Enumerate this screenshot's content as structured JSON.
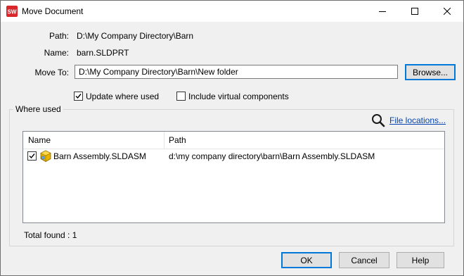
{
  "window": {
    "title": "Move Document",
    "app_icon": "solidworks-icon",
    "controls": [
      "minimize-icon",
      "maximize-icon",
      "close-icon"
    ]
  },
  "form": {
    "path_label": "Path:",
    "path_value": "D:\\My Company Directory\\Barn",
    "name_label": "Name:",
    "name_value": "barn.SLDPRT",
    "move_to_label": "Move To:",
    "move_to_value": "D:\\My Company Directory\\Barn\\New folder",
    "browse_label": "Browse..."
  },
  "options": {
    "update_where_used": {
      "label": "Update where used",
      "checked": true
    },
    "include_virtual": {
      "label": "Include virtual components",
      "checked": false
    }
  },
  "where_used": {
    "group_label": "Where used",
    "file_locations_label": "File locations...",
    "columns": [
      "Name",
      "Path"
    ],
    "rows": [
      {
        "checked": true,
        "icon": "assembly-icon",
        "name": "Barn Assembly.SLDASM",
        "path": "d:\\my company directory\\barn\\Barn Assembly.SLDASM"
      }
    ],
    "total_found": "Total found : 1"
  },
  "buttons": {
    "ok": "OK",
    "cancel": "Cancel",
    "help": "Help"
  }
}
